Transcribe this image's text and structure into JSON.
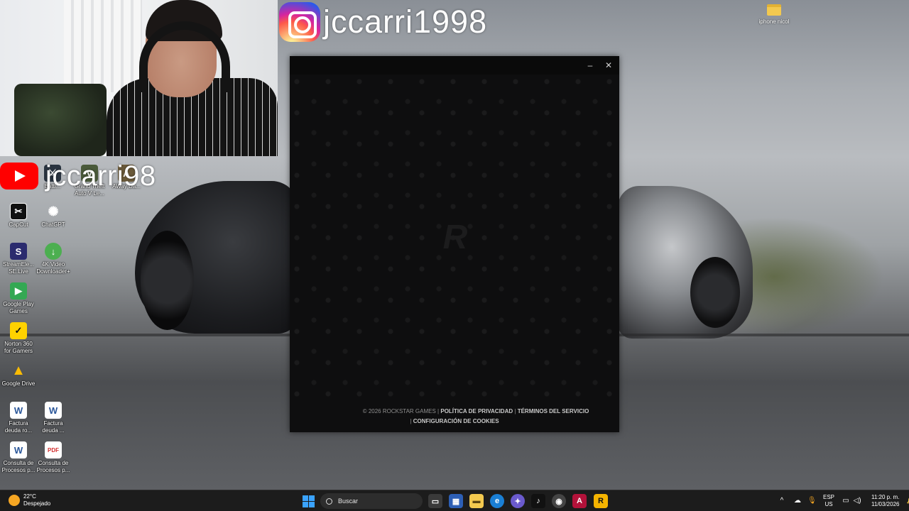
{
  "overlays": {
    "instagram_handle": "jccarri1998",
    "youtube_handle": "jccarri98"
  },
  "desktop_icons": [
    {
      "name": "battle-icon",
      "label": "Battl..."
    },
    {
      "name": "gta-icon",
      "label": "Grand Theft\nAuto V Le..."
    },
    {
      "name": "awaydays-icon",
      "label": "AWay Da..."
    },
    {
      "name": "capcut-icon",
      "label": "CapCut"
    },
    {
      "name": "chatgpt-icon",
      "label": "ChatGPT"
    },
    {
      "name": "streamelements-icon",
      "label": "StreamEle...\nSE.Live"
    },
    {
      "name": "4k-video-icon",
      "label": "4K Video\nDownloader+"
    },
    {
      "name": "google-play-games-icon",
      "label": "Google Play\nGames"
    },
    {
      "name": "norton-icon",
      "label": "Norton 360\nfor Gamers"
    },
    {
      "name": "google-drive-icon",
      "label": "Google Drive"
    },
    {
      "name": "word-doc-icon",
      "label": "Factura\ndeuda ro..."
    },
    {
      "name": "word-doc-icon-2",
      "label": "Factura\ndeuda ..."
    },
    {
      "name": "word-doc-icon-3",
      "label": "Consulta de\nProcesos p..."
    },
    {
      "name": "pdf-icon",
      "label": "Consulta de\nProcesos p..."
    }
  ],
  "top_right_icon": {
    "name": "folder-icon",
    "label": "iphone nicol"
  },
  "launcher": {
    "copyright": "© 2026 ROCKSTAR GAMES",
    "privacy": "POLÍTICA DE PRIVACIDAD",
    "terms": "TÉRMINOS DEL SERVICIO",
    "cookies": "CONFIGURACIÓN DE COOKIES",
    "separator": "|",
    "minimize_glyph": "–",
    "close_glyph": "✕",
    "logo_glyph": "R"
  },
  "taskbar": {
    "temperature": "22°C",
    "weather": "Despejado",
    "search_label": "Buscar",
    "language_top": "ESP",
    "language_bottom": "US",
    "time": "11:20 p. m.",
    "date": "11/03/2026"
  },
  "colors": {
    "youtube_red": "#ff0000",
    "launcher_bg": "#0e0e0f",
    "taskbar_bg": "#1c1c1c",
    "accent_blue": "#3aa3ff"
  }
}
